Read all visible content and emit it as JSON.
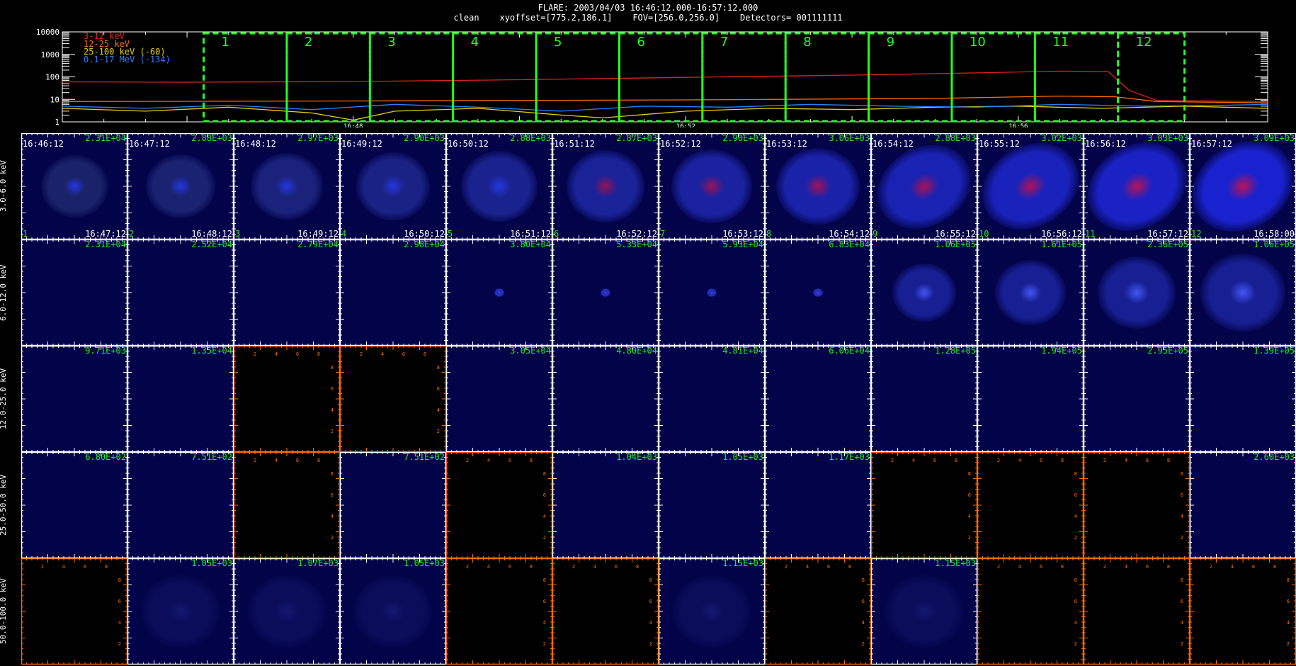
{
  "header": {
    "title": "FLARE: 2003/04/03 16:46:12.000-16:57:12.000",
    "subtitle": "clean    xyoffset=[775.2,186.1]    FOV=[256.0,256.0]    Detectors= 001111111"
  },
  "chart_data": [
    {
      "type": "line",
      "y_scale": "log",
      "ylim": [
        1,
        10000
      ],
      "y_ticks": [
        "10000",
        "1000",
        "100",
        "10",
        "1"
      ],
      "x_tick_labels": [
        "16:48",
        "16:52",
        "16:56"
      ],
      "legend": [
        "3-12 keV",
        "12-25 keV",
        "25-100 keV (-60)",
        "0.1-17 MeV (-134)"
      ],
      "legend_placement": "top-left",
      "x_range": [
        "16:44:30",
        "16:59:00"
      ],
      "series": [
        {
          "name": "3-12 keV",
          "color": "#e02020",
          "x": [
            "16:44:30",
            "16:46:00",
            "16:48:00",
            "16:50:00",
            "16:52:00",
            "16:54:00",
            "16:55:30",
            "16:56:30",
            "16:57:05",
            "16:57:20",
            "16:57:40",
            "16:59:00"
          ],
          "y": [
            60,
            58,
            62,
            75,
            95,
            120,
            150,
            180,
            170,
            25,
            9,
            8
          ]
        },
        {
          "name": "12-25 keV",
          "color": "#ff6a00",
          "x": [
            "16:44:30",
            "16:48:00",
            "16:52:00",
            "16:55:00",
            "16:56:30",
            "16:57:10",
            "16:57:40",
            "16:59:00"
          ],
          "y": [
            8,
            8.5,
            9.5,
            11,
            14,
            13,
            8,
            7
          ]
        },
        {
          "name": "25-100 keV (-60)",
          "color": "#e8d000",
          "x": [
            "16:44:30",
            "16:45:30",
            "16:46:30",
            "16:47:30",
            "16:48:00",
            "16:48:30",
            "16:49:30",
            "16:50:30",
            "16:51:00",
            "16:52:00",
            "16:53:00",
            "16:54:00",
            "16:55:00",
            "16:56:00",
            "16:57:00",
            "16:58:00",
            "16:59:00"
          ],
          "y": [
            4,
            3,
            4.5,
            2.5,
            1.2,
            3,
            4,
            2,
            1.5,
            3,
            4,
            3.5,
            4.5,
            5,
            4,
            5,
            4
          ]
        },
        {
          "name": "0.1-17 MeV (-134)",
          "color": "#2a7fff",
          "x": [
            "16:44:30",
            "16:45:30",
            "16:46:30",
            "16:47:30",
            "16:48:30",
            "16:49:30",
            "16:50:30",
            "16:51:30",
            "16:52:30",
            "16:53:30",
            "16:54:30",
            "16:55:30",
            "16:56:30",
            "16:57:30",
            "16:58:30",
            "16:59:00"
          ],
          "y": [
            5,
            4,
            5.5,
            3.5,
            6,
            4.5,
            3,
            5,
            4.5,
            6,
            5,
            4.5,
            6,
            5,
            5.5,
            6
          ]
        }
      ],
      "intervals": {
        "labels": [
          "1",
          "2",
          "3",
          "4",
          "5",
          "6",
          "7",
          "8",
          "9",
          "10",
          "11",
          "12"
        ],
        "color": "#22ff22",
        "bounds": [
          "16:46:12",
          "16:47:12",
          "16:48:12",
          "16:49:12",
          "16:50:12",
          "16:51:12",
          "16:52:12",
          "16:53:12",
          "16:54:12",
          "16:55:12",
          "16:56:12",
          "16:57:12",
          "16:58:00"
        ]
      }
    },
    {
      "type": "heatmap",
      "rows": [
        "3.0-6.0 keV",
        "6.0-12.0 keV",
        "12.0-25.0 keV",
        "25.0-50.0 keV",
        "50.0-100.0 keV"
      ],
      "columns": [
        "1",
        "2",
        "3",
        "4",
        "5",
        "6",
        "7",
        "8",
        "9",
        "10",
        "11",
        "12"
      ],
      "start_times": [
        "16:46:12",
        "16:47:12",
        "16:48:12",
        "16:49:12",
        "16:50:12",
        "16:51:12",
        "16:52:12",
        "16:53:12",
        "16:54:12",
        "16:55:12",
        "16:56:12",
        "16:57:12"
      ],
      "end_times": [
        "16:47:12",
        "16:48:12",
        "16:49:12",
        "16:50:12",
        "16:51:12",
        "16:52:12",
        "16:53:12",
        "16:54:12",
        "16:55:12",
        "16:56:12",
        "16:57:12",
        "16:58:00"
      ],
      "peaks": [
        [
          "2.31E+04",
          "2.88E+03",
          "2.97E+03",
          "2.90E+03",
          "2.88E+03",
          "2.87E+03",
          "2.90E+03",
          "3.06E+03",
          "2.88E+03",
          "3.02E+03",
          "3.03E+03",
          "3.09E+03"
        ],
        [
          "2.31E+04",
          "2.52E+04",
          "2.79E+04",
          "2.98E+04",
          "3.80E+04",
          "5.33E+04",
          "5.93E+04",
          "6.83E+04",
          "1.06E+05",
          "1.61E+05",
          "2.36E+05",
          "1.06E+05"
        ],
        [
          "9.71E+03",
          "1.35E+04",
          "",
          "",
          "3.05E+04",
          "4.80E+04",
          "4.81E+04",
          "6.06E+04",
          "1.28E+05",
          "1.94E+05",
          "2.95E+05",
          "1.39E+05"
        ],
        [
          "6.80E+02",
          "7.51E+02",
          "",
          "7.51E+02",
          "",
          "1.04E+03",
          "1.05E+03",
          "1.17E+03",
          "",
          "",
          "",
          "2.60E+03"
        ],
        [
          "",
          "1.05E+03",
          "1.07E+03",
          "1.05E+03",
          "",
          "",
          "1.15E+03",
          "",
          "1.15E+03",
          "",
          "",
          ""
        ]
      ],
      "empty_tick_labels": [
        "2",
        "4",
        "6",
        "8"
      ],
      "ticks_color_empty": "#ff6a00",
      "ticks_color": "#ffffff"
    }
  ]
}
